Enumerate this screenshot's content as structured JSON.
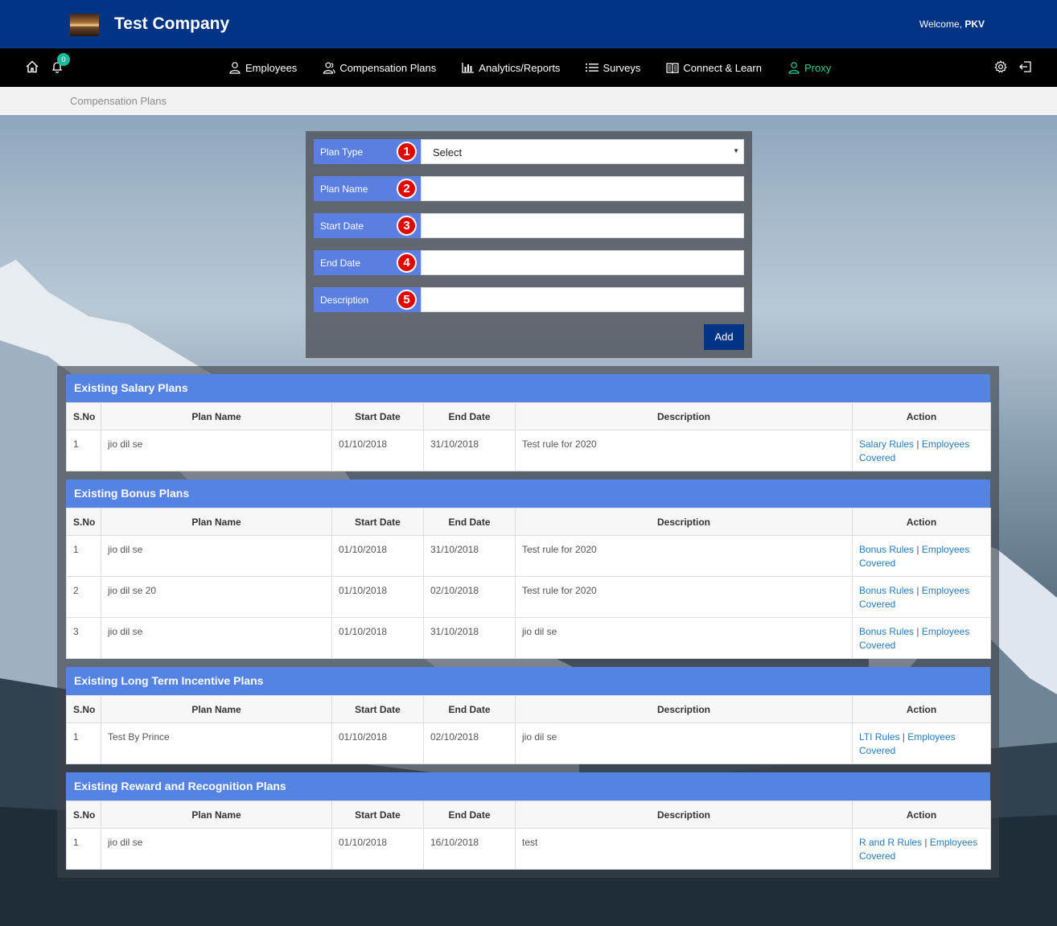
{
  "header": {
    "company": "Test Company",
    "welcome_prefix": "Welcome, ",
    "user": "PKV",
    "notifications_count": "0"
  },
  "nav": {
    "items": [
      {
        "label": "Employees",
        "icon": "user-icon"
      },
      {
        "label": "Compensation Plans",
        "icon": "people-icon"
      },
      {
        "label": "Analytics/Reports",
        "icon": "bar-chart-icon"
      },
      {
        "label": "Surveys",
        "icon": "list-icon"
      },
      {
        "label": "Connect & Learn",
        "icon": "book-icon"
      },
      {
        "label": "Proxy",
        "icon": "user-icon"
      }
    ]
  },
  "breadcrumb": "Compensation Plans",
  "form": {
    "plan_type_label": "Plan Type",
    "plan_type_value": "Select",
    "plan_name_label": "Plan Name",
    "start_date_label": "Start Date",
    "end_date_label": "End Date",
    "description_label": "Description",
    "numbers": [
      "1",
      "2",
      "3",
      "4",
      "5"
    ],
    "add_label": "Add"
  },
  "columns": {
    "sno": "S.No",
    "plan_name": "Plan Name",
    "start_date": "Start Date",
    "end_date": "End Date",
    "description": "Description",
    "action": "Action"
  },
  "common": {
    "sep": " | ",
    "employees": "Employees",
    "covered": "Covered"
  },
  "salary": {
    "title": "Existing Salary Plans",
    "rules": "Salary Rules",
    "rows": [
      {
        "sno": "1",
        "name": "jio dil se",
        "start": "01/10/2018",
        "end": "31/10/2018",
        "desc": "Test rule for 2020"
      }
    ]
  },
  "bonus": {
    "title": "Existing Bonus Plans",
    "rules": "Bonus Rules",
    "rows": [
      {
        "sno": "1",
        "name": "jio dil se",
        "start": "01/10/2018",
        "end": "31/10/2018",
        "desc": "Test rule for 2020"
      },
      {
        "sno": "2",
        "name": "jio dil se 20",
        "start": "01/10/2018",
        "end": "02/10/2018",
        "desc": "Test rule for 2020"
      },
      {
        "sno": "3",
        "name": "jio dil se",
        "start": "01/10/2018",
        "end": "31/10/2018",
        "desc": "jio dil se"
      }
    ]
  },
  "lti": {
    "title": "Existing Long Term Incentive Plans",
    "rules": "LTI Rules",
    "rows": [
      {
        "sno": "1",
        "name": "Test By Prince",
        "start": "01/10/2018",
        "end": "02/10/2018",
        "desc": "jio dil se"
      }
    ]
  },
  "rnr": {
    "title": "Existing Reward and Recognition Plans",
    "rules": "R and R Rules",
    "rows": [
      {
        "sno": "1",
        "name": "jio dil se",
        "start": "01/10/2018",
        "end": "16/10/2018",
        "desc": "test"
      }
    ]
  }
}
